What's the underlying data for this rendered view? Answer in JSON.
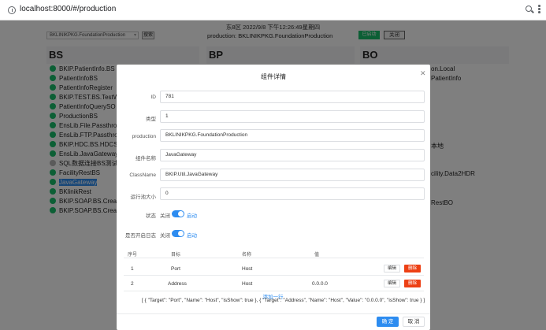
{
  "browser": {
    "url": "localhost:8000/#/production"
  },
  "page": {
    "datetime": "东8区 2022/9/8 下午12:26:49星期四",
    "production_select": "BKLINIKPKG.FoundationProduction",
    "search_label": "搜索",
    "production_label": "production: BKLINIKPKG.FoundationProduction",
    "status_label": "已启动",
    "close_label": "关闭",
    "columns": {
      "bs": "BS",
      "bp": "BP",
      "bo": "BO"
    },
    "bs_items": [
      "BKIP.PatientInfo.BS",
      "PatientInfoBS",
      "PatientInfoRegister",
      "BKIP.TEST.BS.TestW",
      "PatientInfoQuerySO",
      "ProductionBS",
      "EnsLib.File.Passthro",
      "EnsLib.FTP.Passthro",
      "BKIP.HDC.BS.HDCS",
      "EnsLib.JavaGateway",
      "SQL数据连接BS测试",
      "FacilityRestBS",
      "JavaGateway",
      "BKlinikRest",
      "BKIP.SOAP.BS.Crea",
      "BKIP.SOAP.BS.Crea"
    ],
    "bo_items": [
      "on.Local",
      "PatientInfo",
      "本地",
      "cility.Data2HDR",
      "RestBO"
    ]
  },
  "modal": {
    "title": "组件详情",
    "fields": [
      {
        "label": "ID",
        "value": "781"
      },
      {
        "label": "类型",
        "value": "1"
      },
      {
        "label": "production",
        "value": "BKLINIKPKG.FoundationProduction"
      },
      {
        "label": "组件名称",
        "value": "JavaGateway"
      },
      {
        "label": "ClassName",
        "value": "BKIP.Util.JavaGateway"
      },
      {
        "label": "运行池大小",
        "value": "0"
      }
    ],
    "status": {
      "label": "状态",
      "off": "关闭",
      "on": "启动"
    },
    "trace": {
      "label": "是否开启日志",
      "off": "关闭",
      "on": "启动"
    },
    "table": {
      "headers": [
        "序号",
        "目标",
        "名称",
        "值"
      ],
      "rows": [
        {
          "index": "1",
          "target": "Port",
          "name": "Host",
          "value": ""
        },
        {
          "index": "2",
          "target": "Address",
          "name": "Host",
          "value": "0.0.0.0"
        }
      ],
      "edit_label": "编辑",
      "delete_label": "删除"
    },
    "add_row": "添加一行",
    "json_text": "[ { \"Target\": \"Port\", \"Name\": \"Host\", \"isShow\": true }, { \"Target\": \"Address\", \"Name\": \"Host\", \"Value\": \"0.0.0.0\", \"isShow\": true } ]",
    "ok_label": "确 定",
    "cancel_label": "取 消"
  },
  "colors": {
    "primary": "#2d8cf0",
    "success": "#19be6b",
    "danger": "#ed4014"
  }
}
